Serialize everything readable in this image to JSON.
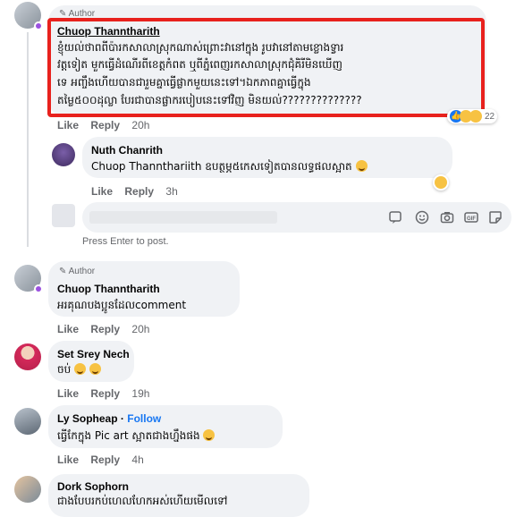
{
  "comments": [
    {
      "author": "Chuop Thanntharith",
      "badge": "Author",
      "text_lines": [
        "ខ្ញុំយល់ថាពពីប៉ារកសាលាស្រុកណាស់ព្រោះវានៅក្នុង រូបវានៅតាមខ្លោងទ្វារ",
        "វត្តទៀត មួកធ្វើដំណើរពីខេត្តកំពត ឬពីភ្នំពេញរកសាលាស្រុកជុំគិរីមិនឃើញ",
        "ទេ អញ្ចឹងហើយបានជារួមគ្នាធ្វើផ្លាកមួយនេះទៅ។ឯកភាពគ្នាធ្វើក្នុង",
        "តម្លៃ៥០០ដុល្លា បែរជាបានផ្លាករបៀបនេះទៅវិញ មិនយល់??????????????"
      ],
      "reaction_count": "22",
      "actions": {
        "like": "Like",
        "reply": "Reply",
        "time": "20h"
      }
    },
    {
      "author": "Nuth Chanrith",
      "text": "Chuop Thannthariith ឧបត្ថម្ភ៥កេសទៀតបានលទ្ធផលស្អាត",
      "actions": {
        "like": "Like",
        "reply": "Reply",
        "time": "3h"
      }
    },
    {
      "author": "Chuop Thanntharith",
      "badge": "Author",
      "text": "អរគុណបងប្អូនដែលcomment",
      "actions": {
        "like": "Like",
        "reply": "Reply",
        "time": "20h"
      }
    },
    {
      "author": "Set Srey Nech",
      "text": "ចប់",
      "actions": {
        "like": "Like",
        "reply": "Reply",
        "time": "19h"
      }
    },
    {
      "author": "Ly Sopheap",
      "follow": "Follow",
      "text": "ធ្វើកែក្នុង Pic art ស្អាតជាងហ្នឹងផង",
      "actions": {
        "like": "Like",
        "reply": "Reply",
        "time": "4h"
      }
    },
    {
      "author": "Dork Sophorn",
      "text": "ជាងបែបរកប់ហេលហែកអស់ហើយមើលទៅ"
    }
  ],
  "composer": {
    "hint": "Press Enter to post."
  },
  "colors": {
    "highlight_box": "#e8211d",
    "bubble": "#f0f2f5",
    "link": "#1877f2",
    "meta": "#65676b"
  },
  "icons": [
    "sticker-icon",
    "emoji-icon",
    "camera-icon",
    "gif-icon",
    "comment-sticker-icon"
  ]
}
